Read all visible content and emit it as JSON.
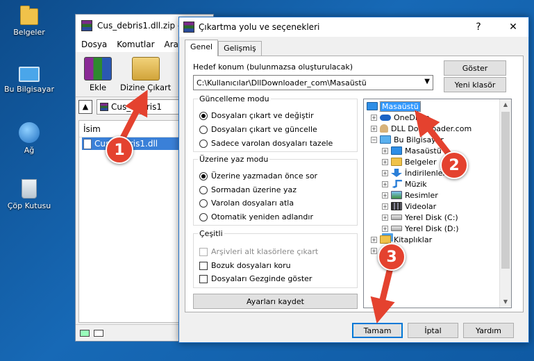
{
  "desktop": {
    "icons": [
      {
        "label": "Belgeler",
        "icon": "folder-icon"
      },
      {
        "label": "Bu Bilgisayar",
        "icon": "computer-icon"
      },
      {
        "label": "Ağ",
        "icon": "network-icon"
      },
      {
        "label": "Çöp Kutusu",
        "icon": "recycle-bin-icon"
      }
    ]
  },
  "winrar": {
    "title": "Cus_debris1.dll.zip -",
    "menu": [
      "Dosya",
      "Komutlar",
      "Araçlar"
    ],
    "toolbar": {
      "add_label": "Ekle",
      "extract_label": "Dizine Çıkart"
    },
    "path": "Cus_debris1",
    "list_header": "İsim",
    "file": "Cus_debris1.dll"
  },
  "dialog": {
    "title": "Çıkartma yolu ve seçenekleri",
    "help_glyph": "?",
    "close_glyph": "✕",
    "tabs": [
      "Genel",
      "Gelişmiş"
    ],
    "dest_label": "Hedef konum (bulunmazsa oluşturulacak)",
    "dest_value": "C:\\Kullanıcılar\\DllDownloader_com\\Masaüstü",
    "show_button": "Göster",
    "new_folder_button": "Yeni klasör",
    "update_group": {
      "title": "Güncelleme modu",
      "options": [
        "Dosyaları çıkart ve değiştir",
        "Dosyaları çıkart ve güncelle",
        "Sadece varolan dosyaları tazele"
      ],
      "selected": 0
    },
    "overwrite_group": {
      "title": "Üzerine yaz modu",
      "options": [
        "Üzerine yazmadan önce sor",
        "Sormadan üzerine yaz",
        "Varolan dosyaları atla",
        "Otomatik yeniden adlandır"
      ],
      "selected": 0
    },
    "misc_group": {
      "title": "Çeşitli",
      "options": [
        "Arşivleri alt klasörlere çıkart",
        "Bozuk dosyaları koru",
        "Dosyaları Gezginde göster"
      ]
    },
    "save_settings_button": "Ayarları kaydet",
    "tree": [
      {
        "label": "Masaüstü",
        "icon": "desktop-icon",
        "selected": true
      },
      {
        "label": "OneDrive",
        "icon": "onedrive-icon"
      },
      {
        "label": "DLL Downloader.com",
        "icon": "user-folder-icon"
      },
      {
        "label": "Bu Bilgisayar",
        "icon": "computer-icon"
      },
      {
        "label": "Masaüstü",
        "icon": "desktop-icon"
      },
      {
        "label": "Belgeler",
        "icon": "documents-icon"
      },
      {
        "label": "İndirilenler",
        "icon": "downloads-icon"
      },
      {
        "label": "Müzik",
        "icon": "music-icon"
      },
      {
        "label": "Resimler",
        "icon": "pictures-icon"
      },
      {
        "label": "Videolar",
        "icon": "videos-icon"
      },
      {
        "label": "Yerel Disk (C:)",
        "icon": "drive-icon"
      },
      {
        "label": "Yerel Disk (D:)",
        "icon": "drive-icon"
      },
      {
        "label": "Kitaplıklar",
        "icon": "libraries-icon"
      }
    ],
    "ok_button": "Tamam",
    "cancel_button": "İptal",
    "help_button": "Yardım"
  },
  "callouts": [
    "1",
    "2",
    "3"
  ],
  "colors": {
    "callout": "#e4422f",
    "selection": "#3399ff",
    "accent": "#0078d7"
  }
}
